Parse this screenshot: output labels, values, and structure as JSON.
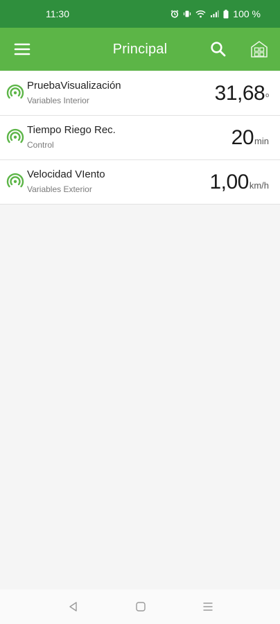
{
  "status_bar": {
    "time": "11:30",
    "battery": "100 %",
    "icons": [
      "alarm-icon",
      "vibrate-icon",
      "wifi-icon",
      "signal-icon",
      "battery-icon"
    ]
  },
  "app_bar": {
    "title": "Principal",
    "icons": [
      "menu-icon",
      "search-icon",
      "greenhouse-icon"
    ],
    "color": "#5cb547",
    "status_color": "#2f8f3d"
  },
  "items": [
    {
      "title": "PruebaVisualización",
      "subtitle": "Variables Interior",
      "value": "31,68",
      "unit": "º",
      "icon": "signal-broadcast-icon"
    },
    {
      "title": "Tiempo Riego Rec.",
      "subtitle": "Control",
      "value": "20",
      "unit": "min",
      "icon": "signal-broadcast-icon"
    },
    {
      "title": "Velocidad VIento",
      "subtitle": "Variables Exterior",
      "value": "1,00",
      "unit": "km/h",
      "icon": "signal-broadcast-icon"
    }
  ],
  "accent": "#5cb547",
  "nav": {
    "icons": [
      "back-icon",
      "home-icon",
      "recents-icon"
    ]
  }
}
